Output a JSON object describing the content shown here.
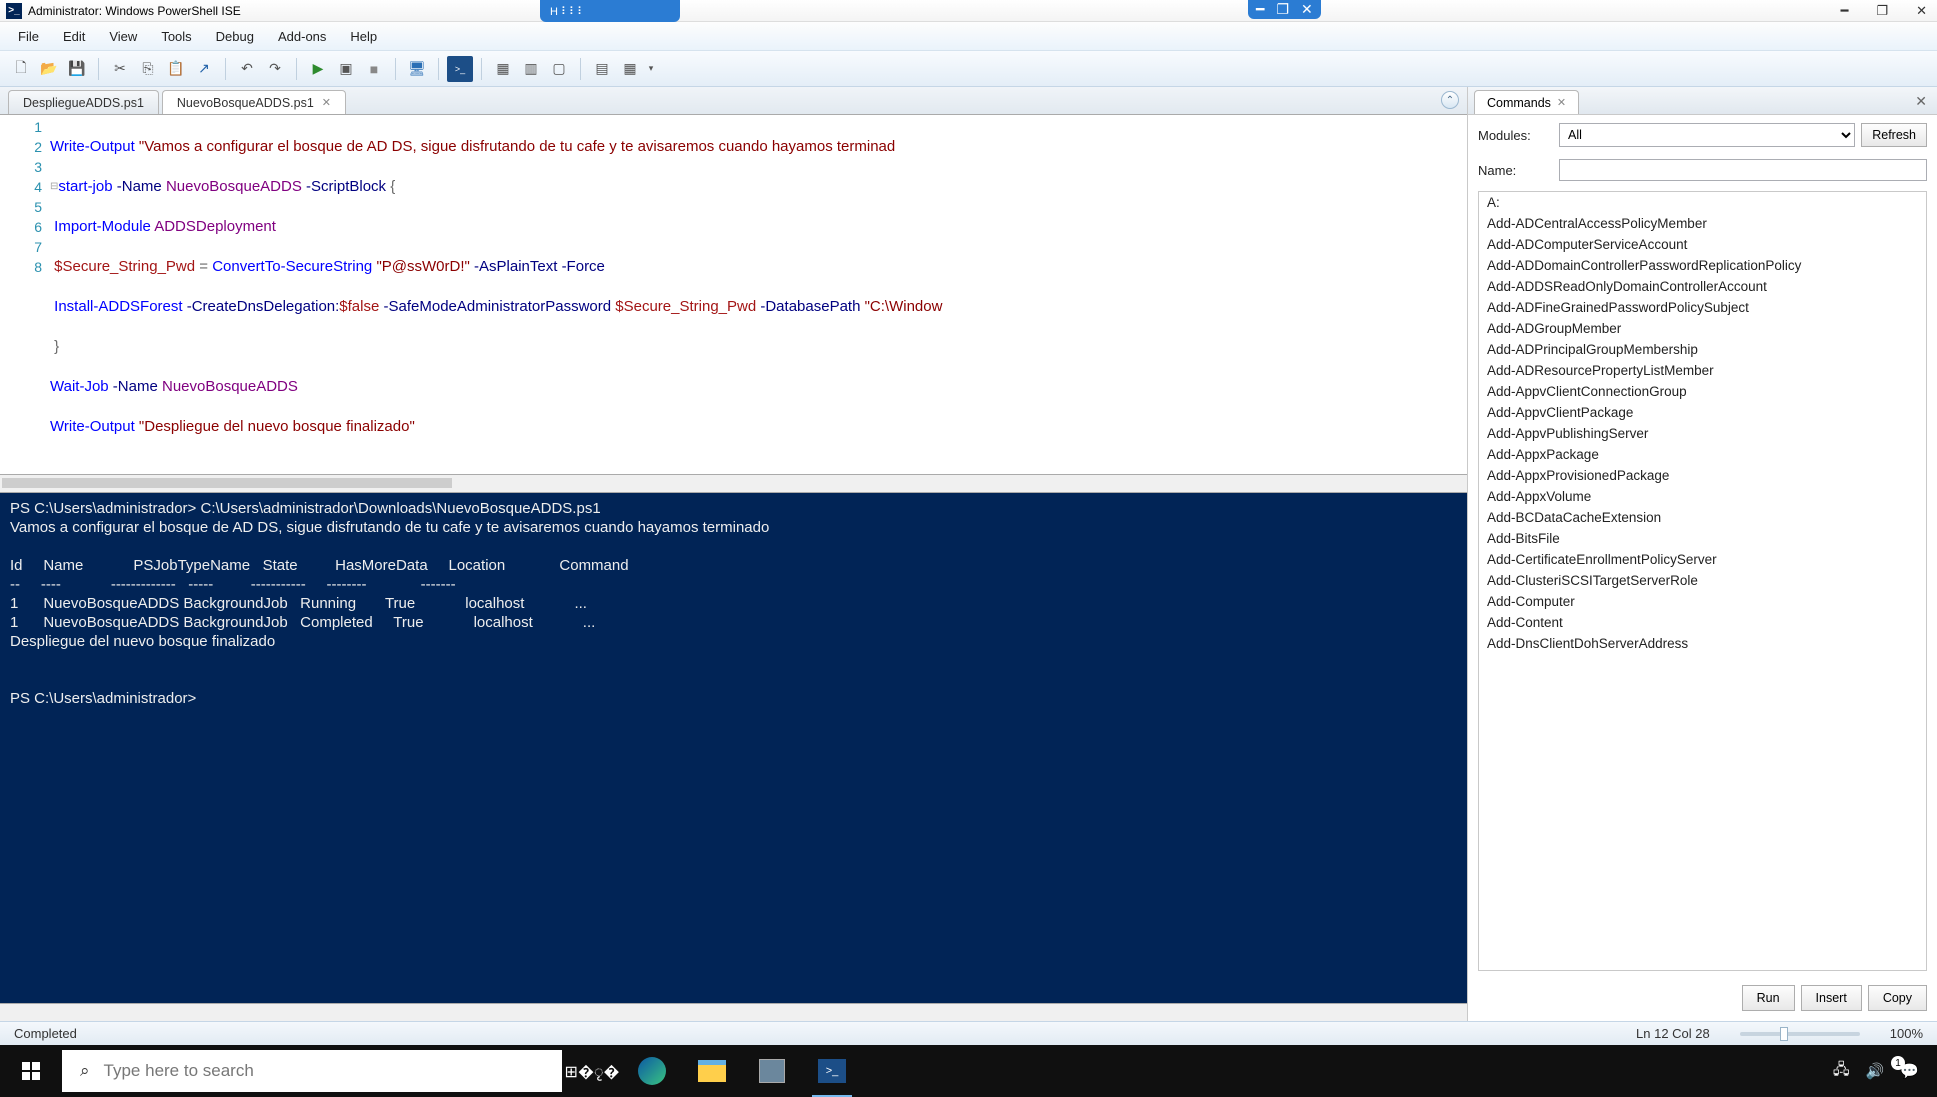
{
  "title": "Administrator: Windows PowerShell ISE",
  "menu": [
    "File",
    "Edit",
    "View",
    "Tools",
    "Debug",
    "Add-ons",
    "Help"
  ],
  "tabs": [
    {
      "label": "DespliegueADDS.ps1",
      "close": false
    },
    {
      "label": "NuevoBosqueADDS.ps1",
      "close": true
    }
  ],
  "code": {
    "nums": [
      "1",
      "2",
      "3",
      "4",
      "5",
      "6",
      "7",
      "8"
    ]
  },
  "console": "PS C:\\Users\\administrador> C:\\Users\\administrador\\Downloads\\NuevoBosqueADDS.ps1\nVamos a configurar el bosque de AD DS, sigue disfrutando de tu cafe y te avisaremos cuando hayamos terminado\n\nId     Name            PSJobTypeName   State         HasMoreData     Location             Command\n--     ----            -------------   -----         -----------     --------             -------\n1      NuevoBosqueADDS BackgroundJob   Running       True            localhost            ...\n1      NuevoBosqueADDS BackgroundJob   Completed     True            localhost            ...\nDespliegue del nuevo bosque finalizado\n\n\nPS C:\\Users\\administrador> ",
  "commands": {
    "title": "Commands",
    "modules_label": "Modules:",
    "modules_value": "All",
    "refresh": "Refresh",
    "name_label": "Name:",
    "name_value": "",
    "list": [
      "A:",
      "Add-ADCentralAccessPolicyMember",
      "Add-ADComputerServiceAccount",
      "Add-ADDomainControllerPasswordReplicationPolicy",
      "Add-ADDSReadOnlyDomainControllerAccount",
      "Add-ADFineGrainedPasswordPolicySubject",
      "Add-ADGroupMember",
      "Add-ADPrincipalGroupMembership",
      "Add-ADResourcePropertyListMember",
      "Add-AppvClientConnectionGroup",
      "Add-AppvClientPackage",
      "Add-AppvPublishingServer",
      "Add-AppxPackage",
      "Add-AppxProvisionedPackage",
      "Add-AppxVolume",
      "Add-BCDataCacheExtension",
      "Add-BitsFile",
      "Add-CertificateEnrollmentPolicyServer",
      "Add-ClusteriSCSITargetServerRole",
      "Add-Computer",
      "Add-Content",
      "Add-DnsClientDohServerAddress"
    ],
    "run": "Run",
    "insert": "Insert",
    "copy": "Copy"
  },
  "status": {
    "left": "Completed",
    "pos": "Ln 12  Col 28",
    "zoom": "100%"
  },
  "taskbar": {
    "search_placeholder": "Type here to search",
    "badge": "1"
  }
}
